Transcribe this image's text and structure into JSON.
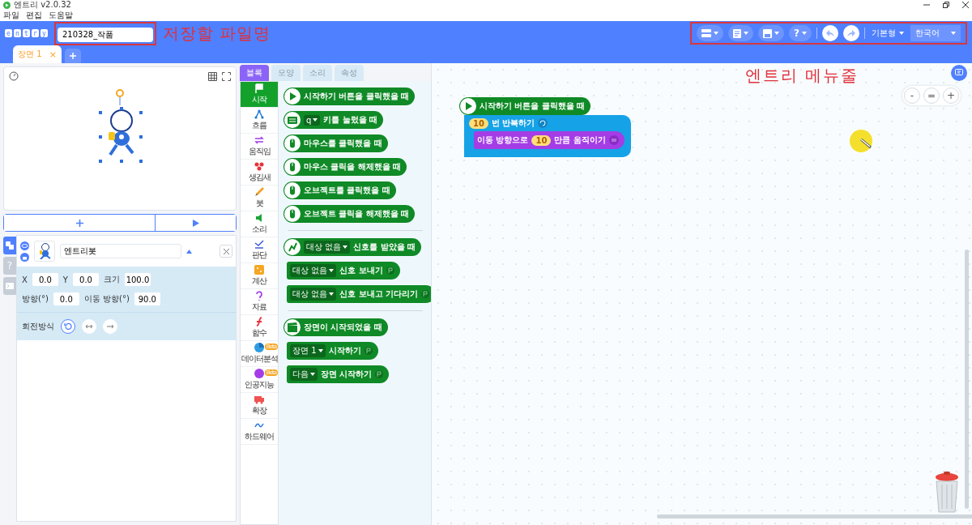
{
  "window": {
    "title": "엔트리 v2.0.32"
  },
  "menu": [
    "파일",
    "편집",
    "도움말"
  ],
  "header": {
    "logo_letters": [
      "e",
      "n",
      "t",
      "r",
      "y"
    ],
    "file_name": "210328_작품",
    "file_annotation": "저장할 파일명",
    "menu_annotation": "엔트리 메뉴줄",
    "toolbar": [
      {
        "kind": "layers"
      },
      {
        "kind": "document"
      },
      {
        "kind": "save"
      },
      {
        "kind": "help",
        "label": "?"
      }
    ],
    "mode": "기본형",
    "language": "한국어"
  },
  "scene_tabs": [
    {
      "label": "장면 1",
      "selected": true,
      "close": "×"
    }
  ],
  "object_panel": {
    "side_tabs": [
      {
        "kind": "object",
        "selected": true
      },
      {
        "kind": "help",
        "label": "?",
        "selected": false
      },
      {
        "kind": "console",
        "selected": false
      }
    ],
    "name": "엔트리봇",
    "rows": [
      [
        {
          "label": "X",
          "value": "0.0"
        },
        {
          "label": "Y",
          "value": "0.0"
        },
        {
          "label": "크기",
          "value": "100.0"
        }
      ],
      [
        {
          "label": "방향(°)",
          "value": "0.0"
        },
        {
          "label": "이동 방향(°)",
          "value": "90.0"
        }
      ]
    ],
    "rotation_label": "회전방식",
    "rotation_modes": [
      {
        "kind": "free",
        "selected": true
      },
      {
        "kind": "horizontal",
        "selected": false
      },
      {
        "kind": "none",
        "selected": false
      }
    ]
  },
  "palette": {
    "tabs": [
      {
        "label": "블록",
        "selected": true
      },
      {
        "label": "모양",
        "selected": false
      },
      {
        "label": "소리",
        "selected": false
      },
      {
        "label": "속성",
        "selected": false
      }
    ],
    "categories": [
      {
        "label": "시작",
        "selected": true
      },
      {
        "label": "흐름",
        "selected": false
      },
      {
        "label": "움직임",
        "selected": false
      },
      {
        "label": "생김새",
        "selected": false
      },
      {
        "label": "붓",
        "selected": false
      },
      {
        "label": "소리",
        "selected": false
      },
      {
        "label": "판단",
        "selected": false
      },
      {
        "label": "계산",
        "selected": false
      },
      {
        "label": "자료",
        "selected": false
      },
      {
        "label": "함수",
        "selected": false
      },
      {
        "label": "데이터분석",
        "selected": false,
        "badge": "Beta"
      },
      {
        "label": "인공지능",
        "selected": false,
        "badge": "Beta"
      },
      {
        "label": "확장",
        "selected": false
      },
      {
        "label": "하드웨어",
        "selected": false
      }
    ],
    "blocks": [
      {
        "kind": "hat",
        "parts": [
          {
            "kind": "text",
            "text": "시작하기 버튼을 클릭했을 때"
          }
        ]
      },
      {
        "kind": "hat",
        "parts": [
          {
            "kind": "dropdown",
            "text": "q"
          },
          {
            "kind": "text",
            "text": "키를 눌렀을 때"
          }
        ]
      },
      {
        "kind": "hat",
        "parts": [
          {
            "kind": "text",
            "text": "마우스를 클릭했을 때"
          }
        ]
      },
      {
        "kind": "hat",
        "parts": [
          {
            "kind": "text",
            "text": "마우스 클릭을 해제했을 때"
          }
        ]
      },
      {
        "kind": "hat",
        "parts": [
          {
            "kind": "text",
            "text": "오브젝트를 클릭했을 때"
          }
        ]
      },
      {
        "kind": "hat",
        "parts": [
          {
            "kind": "text",
            "text": "오브젝트 클릭을 해제했을 때"
          }
        ]
      },
      {
        "kind": "divider"
      },
      {
        "kind": "hat",
        "parts": [
          {
            "kind": "dropdown",
            "text": "대상 없음"
          },
          {
            "kind": "text",
            "text": "신호를 받았을 때"
          }
        ]
      },
      {
        "kind": "command",
        "parts": [
          {
            "kind": "dropdown",
            "text": "대상 없음"
          },
          {
            "kind": "text",
            "text": "신호 보내기"
          }
        ]
      },
      {
        "kind": "command",
        "parts": [
          {
            "kind": "dropdown",
            "text": "대상 없음"
          },
          {
            "kind": "text",
            "text": "신호 보내고 기다리기"
          }
        ]
      },
      {
        "kind": "divider"
      },
      {
        "kind": "hat",
        "parts": [
          {
            "kind": "text",
            "text": "장면이 시작되었을 때"
          }
        ]
      },
      {
        "kind": "command",
        "parts": [
          {
            "kind": "dropdown",
            "text": "장면 1"
          },
          {
            "kind": "text",
            "text": "시작하기"
          }
        ]
      },
      {
        "kind": "command",
        "parts": [
          {
            "kind": "dropdown",
            "text": "다음"
          },
          {
            "kind": "text",
            "text": "장면 시작하기"
          }
        ]
      }
    ]
  },
  "canvas": {
    "zoom": [
      "-",
      "=",
      "+"
    ],
    "script": [
      {
        "kind": "hat",
        "parts": [
          {
            "kind": "text",
            "text": "시작하기 버튼을 클릭했을 때"
          }
        ]
      },
      {
        "kind": "repeat",
        "parts": [
          {
            "kind": "number",
            "text": "10"
          },
          {
            "kind": "text",
            "text": "번 반복하기"
          }
        ],
        "children": [
          {
            "kind": "move",
            "parts": [
              {
                "kind": "text",
                "text": "이동 방향으로"
              },
              {
                "kind": "number",
                "text": "10"
              },
              {
                "kind": "text",
                "text": "만큼 움직이기"
              }
            ]
          }
        ]
      }
    ]
  }
}
